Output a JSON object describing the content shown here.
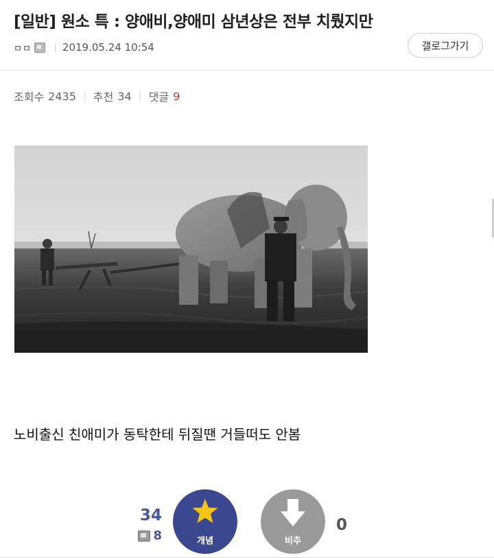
{
  "post": {
    "title": "[일반] 원소 특 : 양애비,양애미 삼년상은 전부 치뤘지만",
    "author": "ㅁㅁ",
    "date": "2019.05.24 10:54",
    "gallery_button": "갤로그가기",
    "author_icon": "gallog-icon"
  },
  "stats": {
    "views_label": "조회수",
    "views": "2435",
    "recommend_label": "추천",
    "recommend": "34",
    "comments_label": "댓글",
    "comments": "9"
  },
  "image": {
    "caption": ""
  },
  "body": {
    "text": "노비출신 친애미가 동탁한테 뒤질땐 거들떠도 안봄"
  },
  "vote": {
    "up_count": "34",
    "fixed_count": "8",
    "up_label": "개념",
    "down_label": "비추",
    "down_count": "0",
    "up_icon": "star-icon",
    "down_icon": "arrow-down-icon"
  },
  "colors": {
    "accent": "#3b4890",
    "up_count": "#4a55a2",
    "down_button": "#9a9a9a",
    "comment_count": "#c0392b"
  }
}
